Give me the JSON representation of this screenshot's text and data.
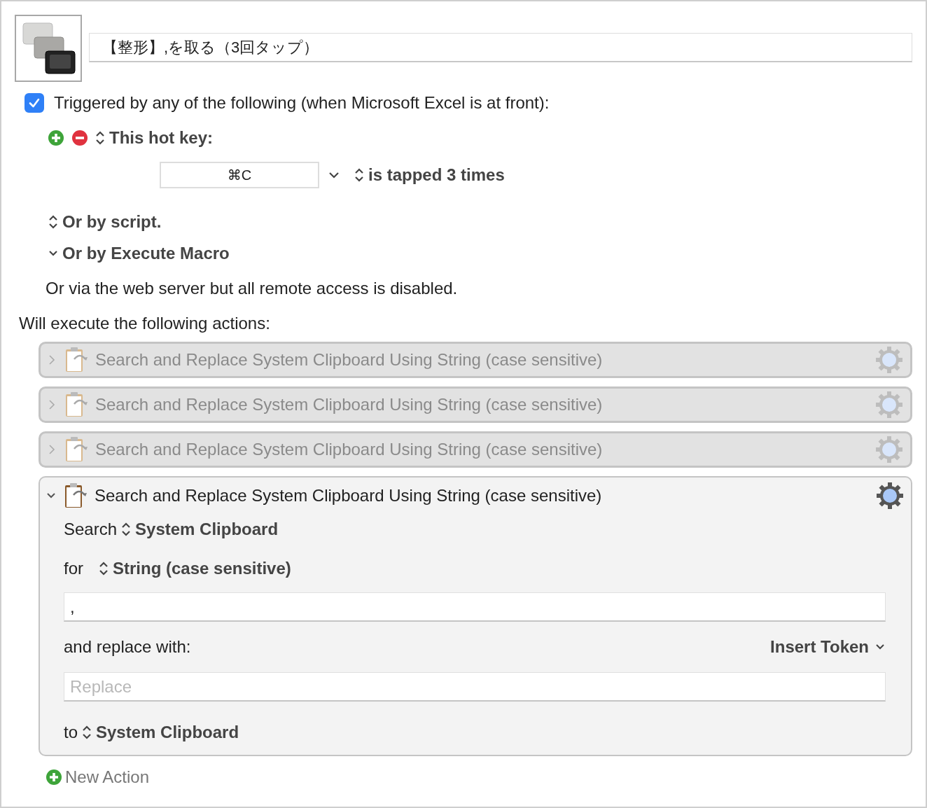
{
  "macro": {
    "name": "【整形】,を取る（3回タップ）"
  },
  "trigger": {
    "checked": true,
    "label": "Triggered by any of the following (when Microsoft Excel is at front):"
  },
  "hot_key": {
    "label": "This hot key:",
    "key": "⌘C",
    "condition": "is tapped 3 times"
  },
  "other_triggers": [
    {
      "kind": "popup",
      "label": "Or by script."
    },
    {
      "kind": "disclosure",
      "label": "Or by Execute Macro"
    }
  ],
  "web_server_note": "Or via the web server but all remote access is disabled.",
  "actions_heading": "Will execute the following actions:",
  "actions": [
    {
      "title": "Search and Replace System Clipboard Using String (case sensitive)",
      "expanded": false,
      "disabled": true
    },
    {
      "title": "Search and Replace System Clipboard Using String (case sensitive)",
      "expanded": false,
      "disabled": true
    },
    {
      "title": "Search and Replace System Clipboard Using String (case sensitive)",
      "expanded": false,
      "disabled": true
    },
    {
      "title": "Search and Replace System Clipboard Using String (case sensitive)",
      "expanded": true,
      "disabled": false
    }
  ],
  "action_detail": {
    "search_label": "Search",
    "search_source": "System Clipboard",
    "for_label": "for",
    "for_mode": "String (case sensitive)",
    "search_value": ",",
    "replace_label": "and replace with:",
    "insert_token": "Insert Token",
    "replace_placeholder": "Replace",
    "to_label": "to",
    "to_target": "System Clipboard"
  },
  "new_action": "New Action"
}
